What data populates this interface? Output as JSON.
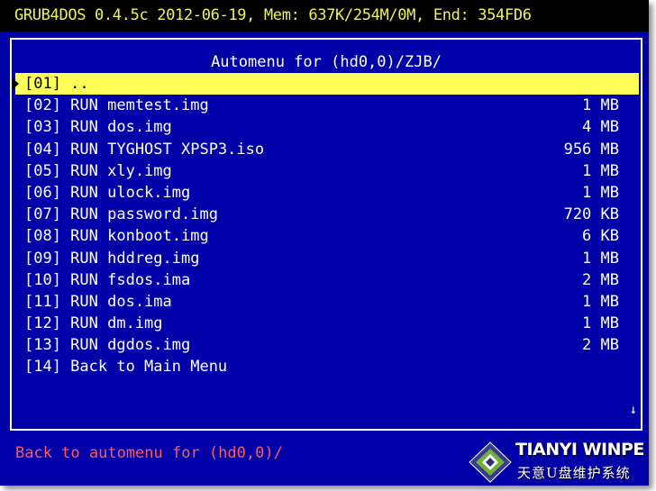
{
  "header": {
    "text": "GRUB4DOS 0.4.5c 2012-06-19, Mem: 637K/254M/0M, End: 354FD6"
  },
  "menu": {
    "title": "Automenu for (hd0,0)/ZJB/",
    "items": [
      {
        "label": "[01] ..",
        "size": "",
        "selected": true
      },
      {
        "label": "[02] RUN memtest.img",
        "size": "1 MB"
      },
      {
        "label": "[03] RUN dos.img",
        "size": "4 MB"
      },
      {
        "label": "[04] RUN TYGHOST XPSP3.iso",
        "size": "956 MB"
      },
      {
        "label": "[05] RUN xly.img",
        "size": "1 MB"
      },
      {
        "label": "[06] RUN ulock.img",
        "size": "1 MB"
      },
      {
        "label": "[07] RUN password.img",
        "size": "720 KB"
      },
      {
        "label": "[08] RUN konboot.img",
        "size": "6 KB"
      },
      {
        "label": "[09] RUN hddreg.img",
        "size": "1 MB"
      },
      {
        "label": "[10] RUN fsdos.ima",
        "size": "2 MB"
      },
      {
        "label": "[11] RUN dos.ima",
        "size": "1 MB"
      },
      {
        "label": "[12] RUN dm.img",
        "size": "1 MB"
      },
      {
        "label": "[13] RUN dgdos.img",
        "size": "2 MB"
      },
      {
        "label": "[14] Back to Main Menu",
        "size": ""
      }
    ],
    "scroll_indicator": "↓"
  },
  "status": {
    "text": "Back to automenu for (hd0,0)/"
  },
  "watermark": {
    "brand": "TIANYI WINPE",
    "subtitle": "天意U盘维护系统",
    "logo_icon": "tianyi-logo-icon"
  },
  "colors": {
    "background": "#0000a8",
    "header_text": "#f2f25a",
    "highlight": "#ffff5a",
    "status_text": "#ff5a5a"
  }
}
